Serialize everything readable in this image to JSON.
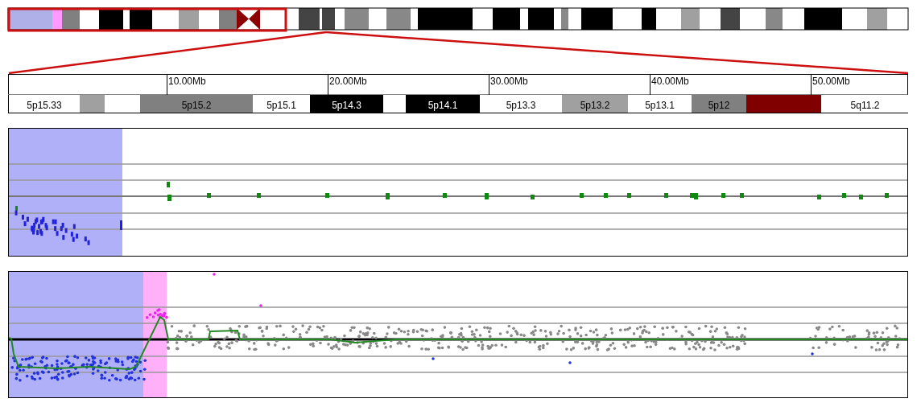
{
  "ruler": {
    "ticks": [
      "10.00Mb",
      "20.00Mb",
      "30.00Mb",
      "40.00Mb",
      "50.00Mb"
    ]
  },
  "bands": [
    {
      "label": "5p15.33",
      "color": "#ffffff"
    },
    {
      "color": "#a0a0a0"
    },
    {
      "label": "5p15.2",
      "color": "#808080"
    },
    {
      "label": "5p15.1",
      "color": "#ffffff"
    },
    {
      "label": "5p14.3",
      "color": "#000000"
    },
    {
      "label": "5p14.1",
      "color": "#000000"
    },
    {
      "label": "5p13.3",
      "color": "#ffffff"
    },
    {
      "label": "5p13.2",
      "color": "#a0a0a0"
    },
    {
      "label": "5p13.1",
      "color": "#ffffff"
    },
    {
      "label": "5p12",
      "color": "#808080"
    },
    {
      "color": "#800000"
    },
    {
      "color": "#800000"
    },
    {
      "label": "5q11.2",
      "color": "#ffffff"
    }
  ]
}
